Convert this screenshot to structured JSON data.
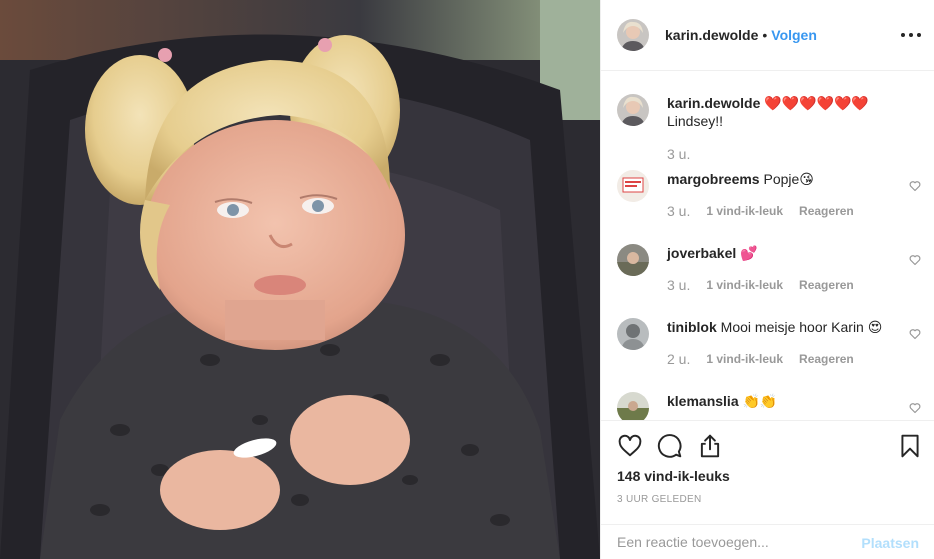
{
  "post": {
    "author": "karin.dewolde",
    "separator": "•",
    "follow_label": "Volgen",
    "more_icon": "ellipsis-icon"
  },
  "caption": {
    "user": "karin.dewolde",
    "text": "❤️❤️❤️❤️❤️❤️Lindsey!!",
    "time": "3 u."
  },
  "comments": [
    {
      "user": "margobreems",
      "text": "Popje😘",
      "time": "3 u.",
      "likes": "1 vind-ik-leuk",
      "reply": "Reageren"
    },
    {
      "user": "joverbakel",
      "text": "💕",
      "time": "3 u.",
      "likes": "1 vind-ik-leuk",
      "reply": "Reageren"
    },
    {
      "user": "tiniblok",
      "text": "Mooi meisje hoor Karin 😍",
      "time": "2 u.",
      "likes": "1 vind-ik-leuk",
      "reply": "Reageren"
    },
    {
      "user": "klemanslia",
      "text": "👏👏"
    }
  ],
  "actions": {
    "like_icon": "heart-icon",
    "comment_icon": "comment-icon",
    "share_icon": "share-icon",
    "save_icon": "bookmark-icon"
  },
  "likes_count": "148 vind-ik-leuks",
  "posted_ago": "3 UUR GELEDEN",
  "add_comment": {
    "placeholder": "Een reactie toevoegen...",
    "post_label": "Plaatsen"
  },
  "colors": {
    "link_blue": "#3897f0",
    "post_disabled": "#b2dffc",
    "muted": "#999999",
    "text": "#262626"
  }
}
